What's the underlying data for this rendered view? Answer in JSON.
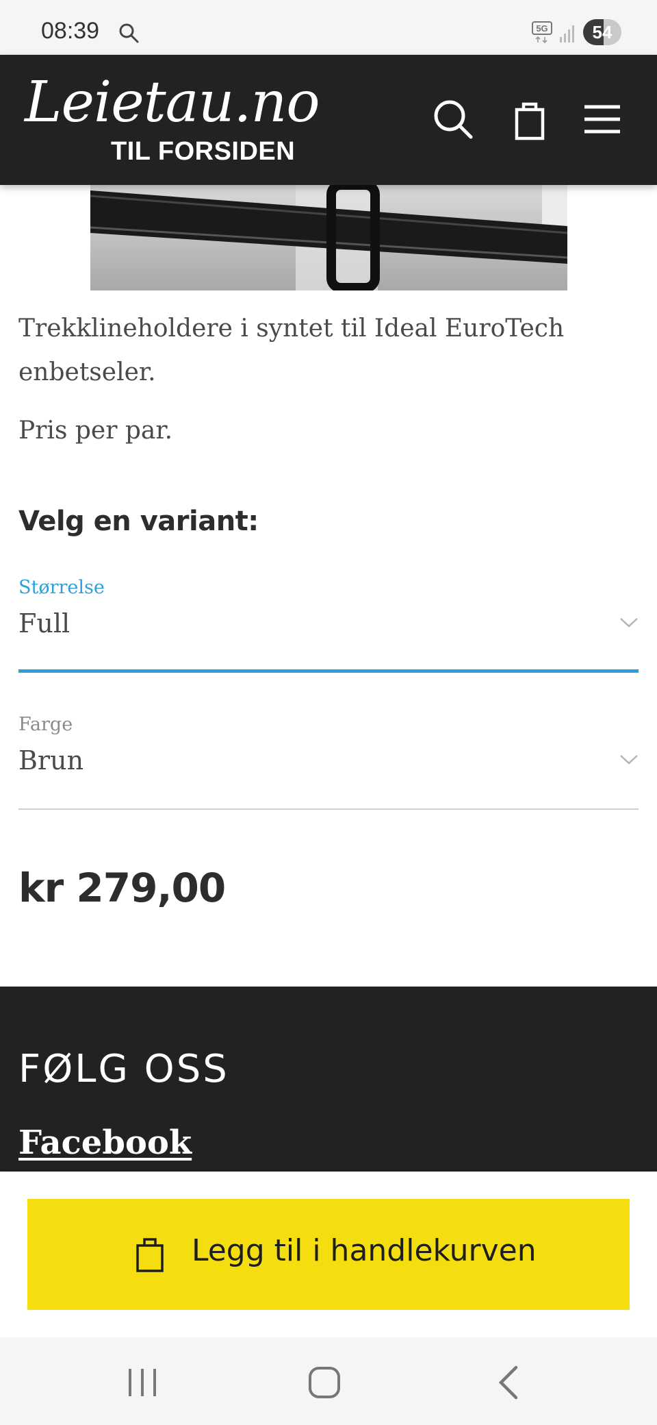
{
  "status_bar": {
    "time": "08:39",
    "network_label": "5G",
    "battery_level": "54",
    "battery_fraction": 0.54,
    "icons": [
      "search-icon",
      "5g-icon",
      "signal-icon",
      "battery-icon"
    ]
  },
  "header": {
    "logo_text": "Leietau.no",
    "logo_subtitle": "TIL FORSIDEN",
    "icons": [
      "search-icon",
      "shopping-bag-icon",
      "menu-icon"
    ],
    "background": "#222222"
  },
  "product": {
    "description": "Trekklineholdere i syntet til Ideal EuroTech enbetseler.",
    "price_note": "Pris per par.",
    "variant_title": "Velg en variant:",
    "fields": [
      {
        "label": "Størrelse",
        "value": "Full",
        "active": true
      },
      {
        "label": "Farge",
        "value": "Brun",
        "active": false
      }
    ],
    "price": "kr 279,00"
  },
  "footer": {
    "heading": "FØLG OSS",
    "links": [
      "Facebook"
    ]
  },
  "cart": {
    "button_label": "Legg til i handlekurven",
    "button_color": "#f5de0f",
    "icon": "shopping-bag-icon"
  },
  "nav_bar": {
    "icons": [
      "recent-apps-icon",
      "home-icon",
      "back-icon"
    ]
  },
  "colors": {
    "accent": "#2f9fd8",
    "cart_yellow": "#f5de0f",
    "dark": "#222222"
  }
}
